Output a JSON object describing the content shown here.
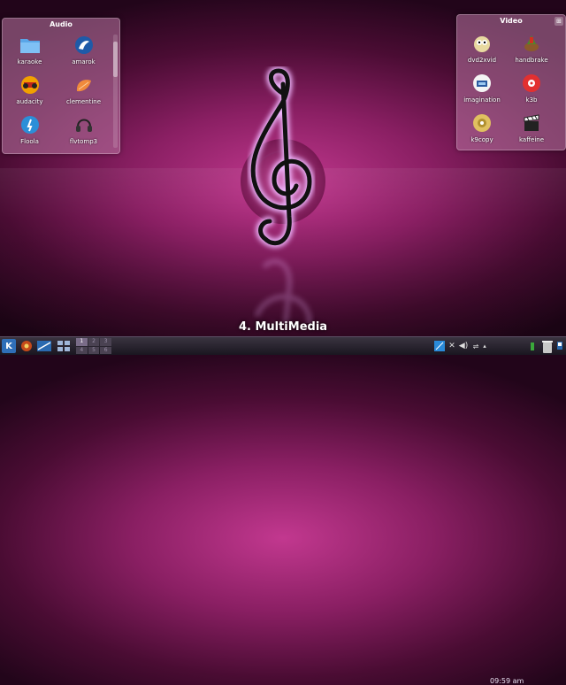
{
  "audio_folder": {
    "title": "Audio",
    "items": [
      {
        "label": "karaoke",
        "icon": "folder-icon"
      },
      {
        "label": "amarok",
        "icon": "amarok-icon"
      },
      {
        "label": "audacity",
        "icon": "audacity-icon"
      },
      {
        "label": "clementine",
        "icon": "clementine-icon"
      },
      {
        "label": "Floola",
        "icon": "floola-icon"
      },
      {
        "label": "flvtomp3",
        "icon": "headphones-icon"
      }
    ]
  },
  "video_folder": {
    "title": "Video",
    "items": [
      {
        "label": "dvd2xvid",
        "icon": "dvd2xvid-icon"
      },
      {
        "label": "handbrake",
        "icon": "handbrake-icon"
      },
      {
        "label": "imagination",
        "icon": "imagination-icon"
      },
      {
        "label": "k3b",
        "icon": "k3b-icon"
      },
      {
        "label": "k9copy",
        "icon": "k9copy-icon"
      },
      {
        "label": "kaffeine",
        "icon": "kaffeine-icon"
      }
    ]
  },
  "activity": {
    "title": "4. MultiMedia"
  },
  "pager": {
    "desktops": [
      "1",
      "2",
      "3",
      "4",
      "5",
      "6"
    ],
    "active": "1"
  },
  "panel": {
    "clock": "09:59 am"
  },
  "colors": {
    "accent": "#c2388f",
    "panel": "#2a2430",
    "glow": "#e7a0ff"
  }
}
